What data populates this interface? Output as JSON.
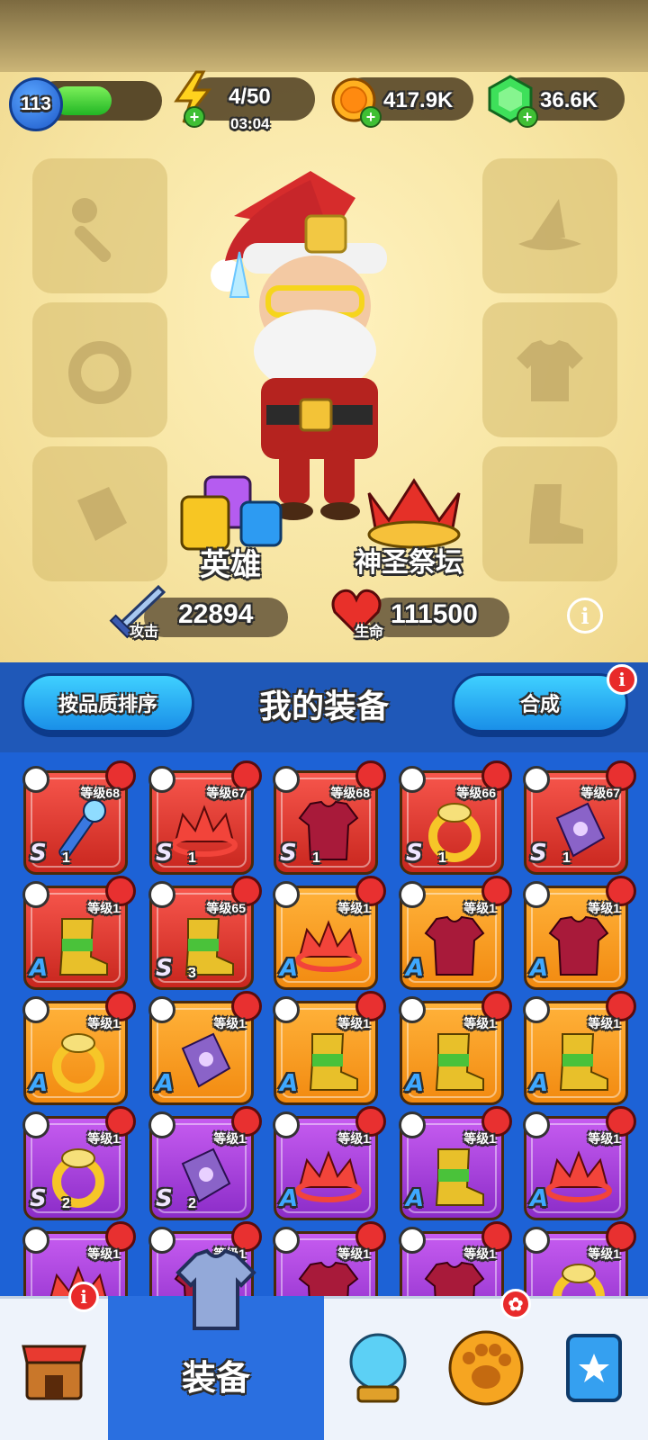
{
  "resources": {
    "player_level": "113",
    "xp_fill_fraction": 0.55,
    "energy": "4/50",
    "energy_timer": "03:04",
    "coins": "417.9K",
    "gems": "36.6K"
  },
  "hero_area": {
    "hero_tab_label": "英雄",
    "altar_label": "神圣祭坛",
    "attack_tag": "攻击",
    "attack_value": "22894",
    "hp_tag": "生命",
    "hp_value": "111500",
    "info_glyph": "i"
  },
  "panel": {
    "sort_button": "按品质排序",
    "title": "我的装备",
    "merge_button": "合成",
    "merge_badge": "i"
  },
  "equipment": [
    {
      "level": "等级68",
      "tier": "S",
      "count": "1",
      "color": "red",
      "icon": "staff"
    },
    {
      "level": "等级67",
      "tier": "S",
      "count": "1",
      "color": "red",
      "icon": "crown"
    },
    {
      "level": "等级68",
      "tier": "S",
      "count": "1",
      "color": "red",
      "icon": "armor"
    },
    {
      "level": "等级66",
      "tier": "S",
      "count": "1",
      "color": "red",
      "icon": "ring"
    },
    {
      "level": "等级67",
      "tier": "S",
      "count": "1",
      "color": "red",
      "icon": "bracer"
    },
    {
      "level": "等级1",
      "tier": "A",
      "count": "",
      "color": "red",
      "icon": "boot"
    },
    {
      "level": "等级65",
      "tier": "S",
      "count": "3",
      "color": "red",
      "icon": "boot"
    },
    {
      "level": "等级1",
      "tier": "A",
      "count": "",
      "color": "orange",
      "icon": "crown"
    },
    {
      "level": "等级1",
      "tier": "A",
      "count": "",
      "color": "orange",
      "icon": "armor"
    },
    {
      "level": "等级1",
      "tier": "A",
      "count": "",
      "color": "orange",
      "icon": "armor"
    },
    {
      "level": "等级1",
      "tier": "A",
      "count": "",
      "color": "orange",
      "icon": "ring"
    },
    {
      "level": "等级1",
      "tier": "A",
      "count": "",
      "color": "orange",
      "icon": "bracer"
    },
    {
      "level": "等级1",
      "tier": "A",
      "count": "",
      "color": "orange",
      "icon": "boot"
    },
    {
      "level": "等级1",
      "tier": "A",
      "count": "",
      "color": "orange",
      "icon": "boot"
    },
    {
      "level": "等级1",
      "tier": "A",
      "count": "",
      "color": "orange",
      "icon": "boot"
    },
    {
      "level": "等级1",
      "tier": "S",
      "count": "2",
      "color": "purple",
      "icon": "ring"
    },
    {
      "level": "等级1",
      "tier": "S",
      "count": "2",
      "color": "purple",
      "icon": "bracer"
    },
    {
      "level": "等级1",
      "tier": "A",
      "count": "",
      "color": "purple",
      "icon": "crown"
    },
    {
      "level": "等级1",
      "tier": "A",
      "count": "",
      "color": "purple",
      "icon": "boot"
    },
    {
      "level": "等级1",
      "tier": "A",
      "count": "",
      "color": "purple",
      "icon": "crown"
    },
    {
      "level": "等级1",
      "tier": "",
      "count": "",
      "color": "purple",
      "icon": "crown"
    },
    {
      "level": "等级1",
      "tier": "",
      "count": "",
      "color": "purple",
      "icon": "armor"
    },
    {
      "level": "等级1",
      "tier": "",
      "count": "",
      "color": "purple",
      "icon": "armor"
    },
    {
      "level": "等级1",
      "tier": "",
      "count": "",
      "color": "purple",
      "icon": "armor"
    },
    {
      "level": "等级1",
      "tier": "",
      "count": "",
      "color": "purple",
      "icon": "ring"
    }
  ],
  "nav": {
    "items": [
      {
        "name": "shop-icon"
      },
      {
        "name": "equipment-icon",
        "label": "装备"
      },
      {
        "name": "crystal-ball-icon"
      },
      {
        "name": "pet-paw-icon"
      },
      {
        "name": "star-card-icon"
      }
    ],
    "shop_badge": "i"
  },
  "colors": {
    "panel_blue": "#1f58b8",
    "grid_blue": "#1d62d6",
    "rarity_red": "#e0392f",
    "rarity_orange": "#f59a1e",
    "rarity_purple": "#a845dc",
    "hero_bg": "#f4df96"
  }
}
